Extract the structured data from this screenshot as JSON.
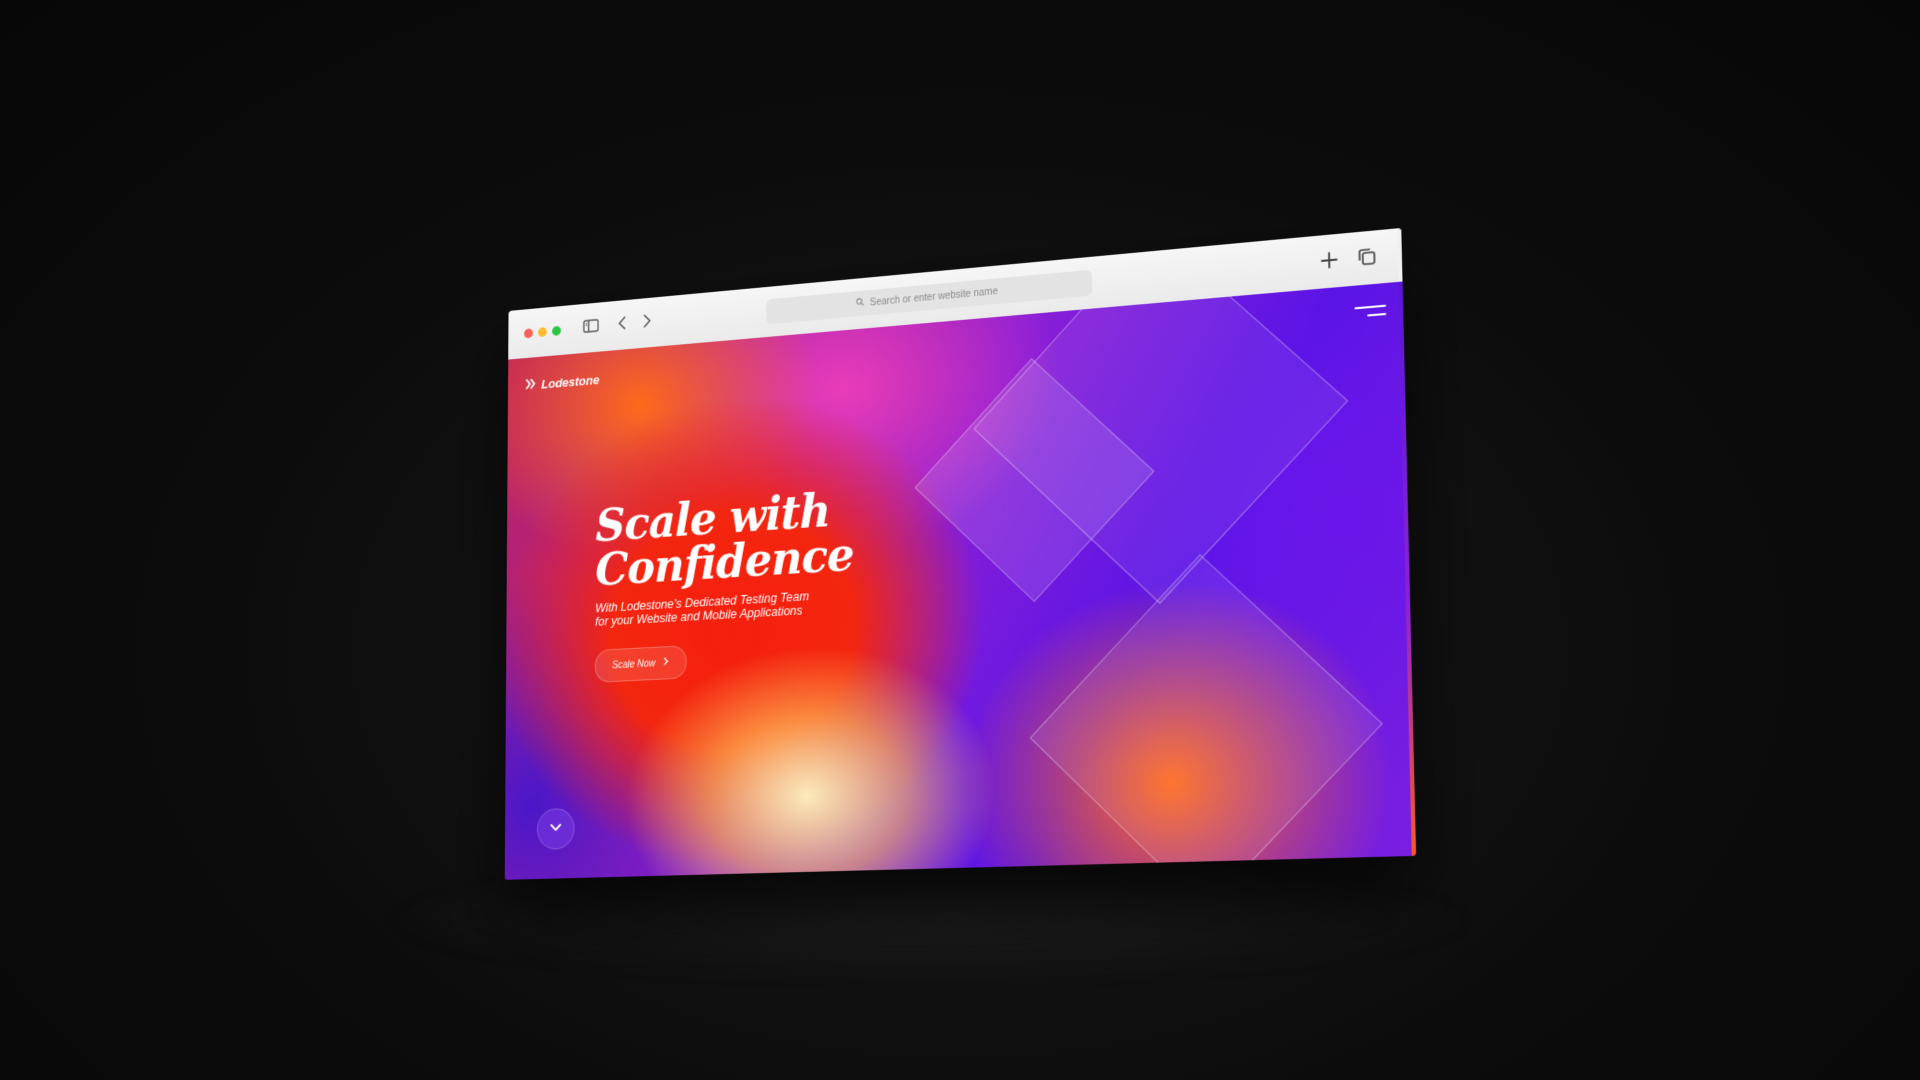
{
  "browser": {
    "traffic_lights": {
      "close_color": "#ff5f57",
      "minimize_color": "#febc2e",
      "maximize_color": "#28c840"
    },
    "toolbar_icons": [
      "sidebar-icon",
      "back-icon",
      "forward-icon",
      "plus-icon",
      "tabs-icon"
    ],
    "address_placeholder": "Search or enter website name"
  },
  "site": {
    "logo_text": "Lodestone",
    "hero": {
      "title_line1": "Scale with",
      "title_line2": "Confidence",
      "subtitle_line1": "With Lodestone’s Dedicated Testing Team",
      "subtitle_line2": "for your Website and Mobile Applications",
      "cta_label": "Scale Now"
    },
    "colors": {
      "red": "#f51f0e",
      "purple": "#5a14e6",
      "orange": "#ff6a1e",
      "pink": "#e93cb9",
      "cream": "#fff5be"
    }
  }
}
